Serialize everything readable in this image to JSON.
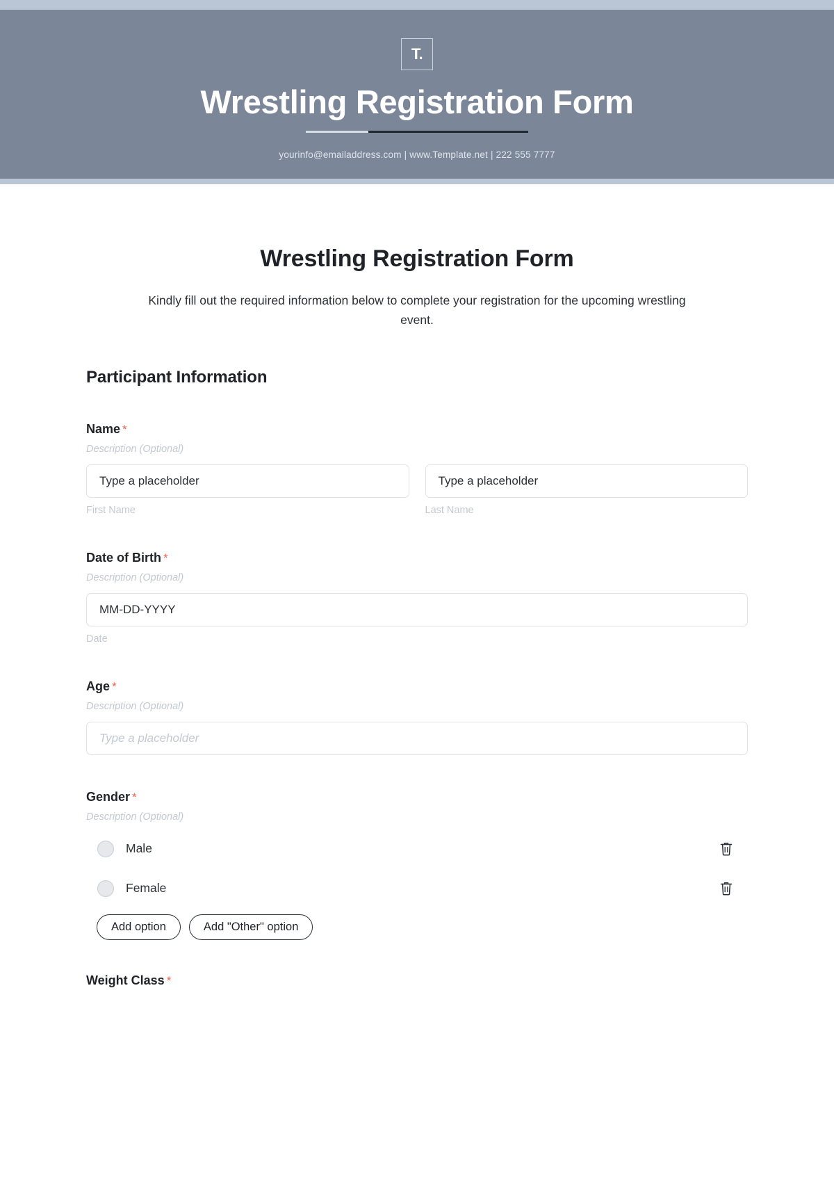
{
  "banner": {
    "logo_text": "T.",
    "title": "Wrestling Registration Form",
    "contact": "yourinfo@emailaddress.com  |  www.Template.net  |  222 555 7777",
    "bg_color": "#7b8798",
    "strip_color": "#b9c6d6"
  },
  "form": {
    "title": "Wrestling Registration Form",
    "description": "Kindly fill out the required information below to complete your registration for the upcoming wrestling event.",
    "section_heading": "Participant Information",
    "required_marker": "*",
    "required_color": "#f4634f",
    "description_placeholder": "Description (Optional)",
    "fields": [
      {
        "label": "Name",
        "description": "Description (Optional)",
        "inputs": [
          {
            "value": "Type a placeholder",
            "sub_label": "First Name"
          },
          {
            "value": "Type a placeholder",
            "sub_label": "Last Name"
          }
        ]
      },
      {
        "label": "Date of Birth",
        "description": "Description (Optional)",
        "inputs": [
          {
            "value": "MM-DD-YYYY",
            "sub_label": "Date"
          }
        ]
      },
      {
        "label": "Age",
        "description": "Description (Optional)",
        "inputs": [
          {
            "value": "Type a placeholder",
            "sub_label": ""
          }
        ]
      },
      {
        "label": "Gender",
        "description": "Description (Optional)",
        "options": [
          {
            "label": "Male",
            "delete_icon": "trash-icon"
          },
          {
            "label": "Female",
            "delete_icon": "trash-icon"
          }
        ],
        "add_option_label": "Add option",
        "add_other_label": "Add \"Other\" option"
      },
      {
        "label": "Weight Class",
        "description": "",
        "inputs": []
      }
    ]
  }
}
